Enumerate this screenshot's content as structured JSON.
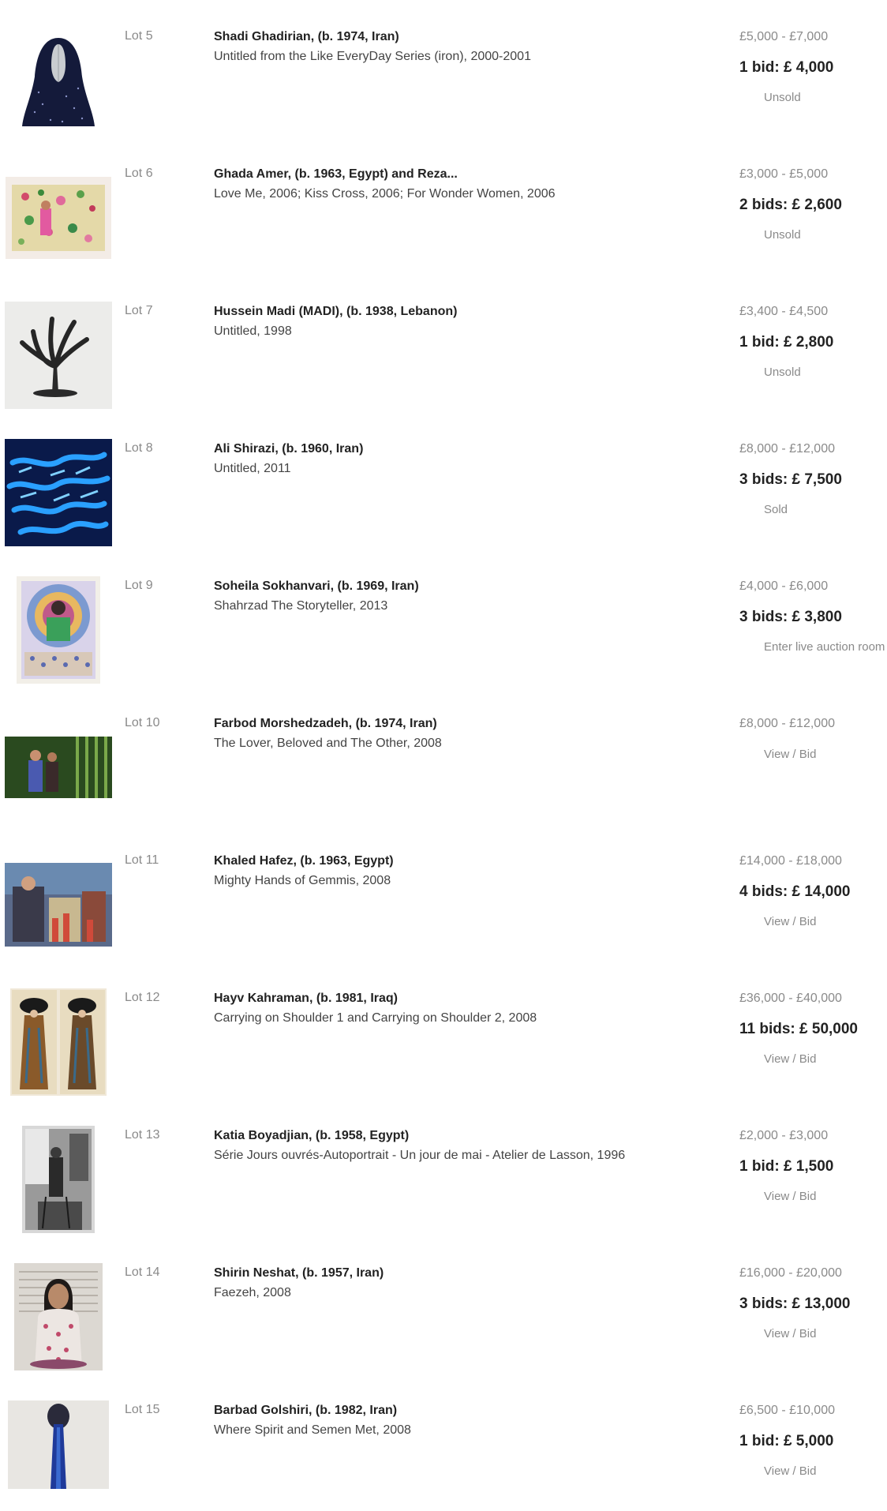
{
  "lots": [
    {
      "lot": "Lot 5",
      "artist": "Shadi Ghadirian, (b. 1974, Iran)",
      "title": "Untitled from the Like EveryDay Series (iron), 2000-2001",
      "estimate": "£5,000 - £7,000",
      "bids": "1 bid: £ 4,000",
      "status": "Unsold"
    },
    {
      "lot": "Lot 6",
      "artist": "Ghada Amer, (b. 1963, Egypt) and Reza...",
      "title": "Love Me, 2006; Kiss Cross, 2006; For Wonder Women, 2006",
      "estimate": "£3,000 - £5,000",
      "bids": "2 bids: £ 2,600",
      "status": "Unsold"
    },
    {
      "lot": "Lot 7",
      "artist": "Hussein Madi (MADI), (b. 1938, Lebanon)",
      "title": "Untitled, 1998",
      "estimate": "£3,400 - £4,500",
      "bids": "1 bid: £ 2,800",
      "status": "Unsold"
    },
    {
      "lot": "Lot 8",
      "artist": "Ali Shirazi, (b. 1960, Iran)",
      "title": "Untitled, 2011",
      "estimate": "£8,000 - £12,000",
      "bids": "3 bids: £ 7,500",
      "status": "Sold"
    },
    {
      "lot": "Lot 9",
      "artist": "Soheila Sokhanvari, (b. 1969, Iran)",
      "title": "Shahrzad The Storyteller, 2013",
      "estimate": "£4,000 - £6,000",
      "bids": "3 bids: £ 3,800",
      "status": "Enter live auction room"
    },
    {
      "lot": "Lot 10",
      "artist": "Farbod Morshedzadeh, (b. 1974, Iran)",
      "title": "The Lover, Beloved and The Other, 2008",
      "estimate": "£8,000 - £12,000",
      "bids": "",
      "status": "View / Bid"
    },
    {
      "lot": "Lot 11",
      "artist": "Khaled Hafez, (b. 1963, Egypt)",
      "title": "Mighty Hands of Gemmis, 2008",
      "estimate": "£14,000 - £18,000",
      "bids": "4 bids: £ 14,000",
      "status": "View / Bid"
    },
    {
      "lot": "Lot 12",
      "artist": "Hayv Kahraman, (b. 1981, Iraq)",
      "title": "Carrying on Shoulder 1 and Carrying on Shoulder 2, 2008",
      "estimate": "£36,000 - £40,000",
      "bids": "11 bids: £ 50,000",
      "status": "View / Bid"
    },
    {
      "lot": "Lot 13",
      "artist": "Katia Boyadjian, (b. 1958, Egypt)",
      "title": "Série Jours ouvrés-Autoportrait - Un jour de mai - Atelier de Lasson, 1996",
      "estimate": "£2,000 - £3,000",
      "bids": "1 bid: £ 1,500",
      "status": "View / Bid"
    },
    {
      "lot": "Lot 14",
      "artist": "Shirin Neshat, (b. 1957, Iran)",
      "title": "Faezeh, 2008",
      "estimate": "£16,000 - £20,000",
      "bids": "3 bids: £ 13,000",
      "status": "View / Bid"
    },
    {
      "lot": "Lot 15",
      "artist": "Barbad Golshiri, (b. 1982, Iran)",
      "title": "Where Spirit and Semen Met, 2008",
      "estimate": "£6,500 - £10,000",
      "bids": "1 bid: £ 5,000",
      "status": "View / Bid"
    }
  ]
}
